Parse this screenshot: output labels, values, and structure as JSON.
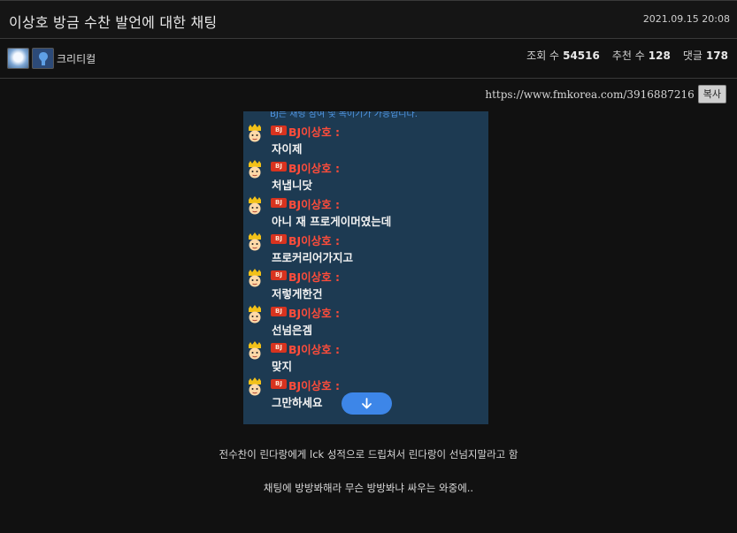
{
  "post": {
    "title": "이상호 방금 수찬 발언에 대한 채팅",
    "date": "2021.09.15 20:08",
    "author": "크리티컬",
    "stats": {
      "views_label": "조회 수",
      "views": "54516",
      "likes_label": "추천 수",
      "likes": "128",
      "comments_label": "댓글",
      "comments": "178"
    },
    "url": "https://www.fmkorea.com/3916887216",
    "copy_label": "복사"
  },
  "chat": {
    "notice": "BJ는 채팅 참여 및 목이기가 가능합니다.",
    "badge": "BJ",
    "messages": [
      {
        "name": "BJ이상호 :",
        "text": "자이제"
      },
      {
        "name": "BJ이상호 :",
        "text": "처냅니닷"
      },
      {
        "name": "BJ이상호 :",
        "text": "아니 재 프로게이머였는데"
      },
      {
        "name": "BJ이상호 :",
        "text": "프로커리어가지고"
      },
      {
        "name": "BJ이상호 :",
        "text": "저렇게한건"
      },
      {
        "name": "BJ이상호 :",
        "text": "선넘은겜"
      },
      {
        "name": "BJ이상호 :",
        "text": "맞지"
      },
      {
        "name": "BJ이상호 :",
        "text": "그만하세요"
      }
    ]
  },
  "body": {
    "line1": "전수찬이 린다랑에게 lck 성적으로 드립쳐서 린다랑이 선넘지말라고 함",
    "line2": "채팅에 방방봐해라 무슨 방방봐냐 싸우는 와중에.."
  },
  "colors": {
    "background": "#111111",
    "chat_bg": "#1d3a52",
    "bj_name": "#ff4c3a",
    "scroll_button": "#3d86e8"
  }
}
